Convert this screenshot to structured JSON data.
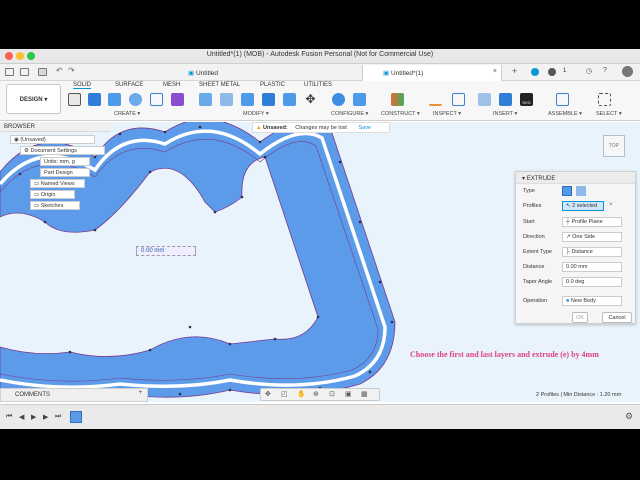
{
  "window": {
    "title": "Untitled*(1) (MOB) - Autodesk Fusion Personal (Not for Commercial Use)"
  },
  "tabs": [
    {
      "label": "Untitled"
    },
    {
      "label": "Untitled*(1)"
    }
  ],
  "quick_icons": [
    "app-grid-icon",
    "file-icon",
    "save-icon",
    "undo-icon",
    "redo-icon"
  ],
  "notifications": {
    "count": "1"
  },
  "ribbon": {
    "design_label": "DESIGN",
    "tabs": [
      "SOLID",
      "SURFACE",
      "MESH",
      "SHEET METAL",
      "PLASTIC",
      "UTILITIES"
    ],
    "groups": [
      "CREATE",
      "MODIFY",
      "CONFIGURE",
      "CONSTRUCT",
      "INSPECT",
      "INSERT",
      "ASSEMBLE",
      "SELECT"
    ]
  },
  "warning": {
    "label": "Unsaved:",
    "message": "Changes may be lost",
    "save_label": "Save"
  },
  "browser": {
    "title": "BROWSER",
    "items": [
      {
        "label": "(Unsaved)"
      },
      {
        "label": "Document Settings"
      },
      {
        "label": "Units: mm, g"
      },
      {
        "label": "Part Design"
      },
      {
        "label": "Named Views"
      },
      {
        "label": "Origin"
      },
      {
        "label": "Sketches"
      }
    ]
  },
  "viewcube": {
    "label": "TOP"
  },
  "dimension_input": {
    "value": "0.00 mm"
  },
  "extrude": {
    "title": "EXTRUDE",
    "type_label": "Type",
    "profiles_label": "Profiles",
    "profiles_value": "2 selected",
    "start_label": "Start",
    "start_value": "Profile Plane",
    "direction_label": "Direction",
    "direction_value": "One Side",
    "extent_label": "Extent Type",
    "extent_value": "Distance",
    "distance_label": "Distance",
    "distance_value": "0.00 mm",
    "taper_label": "Taper Angle",
    "taper_value": "0.0 deg",
    "operation_label": "Operation",
    "operation_value": "New Body",
    "ok_label": "OK",
    "cancel_label": "Cancel"
  },
  "instruction": "Choose the first and last layers and extrude (e) by 4mm",
  "comments": {
    "label": "COMMENTS"
  },
  "status": {
    "text": "2 Profiles | Min Distance : 1.20 mm"
  },
  "colors": {
    "profile_fill": "#5b9bea",
    "viewport_bg": "#e9f3fb",
    "accent": "#0696d7",
    "instruction": "#e0408a"
  }
}
